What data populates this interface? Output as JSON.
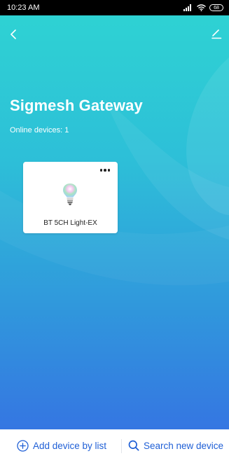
{
  "status_bar": {
    "time": "10:23 AM",
    "battery": "68",
    "icons": [
      "signal-icon",
      "wifi-icon",
      "battery-icon"
    ]
  },
  "header": {
    "back_icon": "chevron-left-icon",
    "edit_icon": "edit-icon"
  },
  "gateway": {
    "title": "Sigmesh Gateway",
    "online_devices": "Online devices: 1"
  },
  "devices": [
    {
      "name": "BT 5CH Light-EX",
      "icon": "bulb-icon",
      "menu_icon": "more-icon"
    }
  ],
  "bottom_bar": {
    "add_label": "Add device by list",
    "add_icon": "plus-circle-icon",
    "search_label": "Search new device",
    "search_icon": "search-icon"
  },
  "colors": {
    "gradient_top": "#2ed2d3",
    "gradient_bottom": "#3576e2",
    "accent": "#1f5fd6"
  }
}
